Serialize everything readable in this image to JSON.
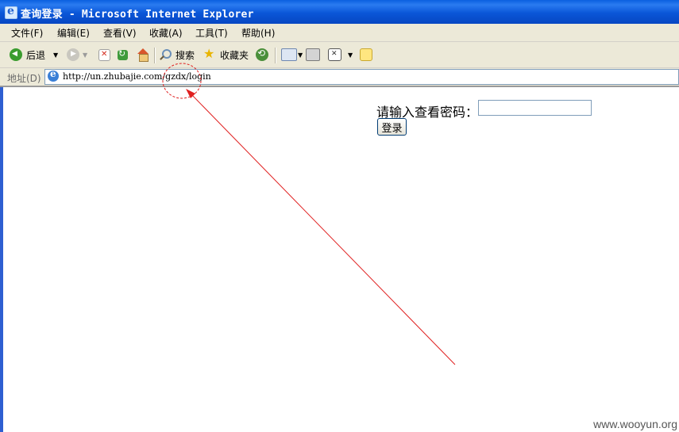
{
  "window": {
    "title": "查询登录 - Microsoft Internet Explorer"
  },
  "menu": {
    "items": [
      {
        "label": "文件(F)"
      },
      {
        "label": "编辑(E)"
      },
      {
        "label": "查看(V)"
      },
      {
        "label": "收藏(A)"
      },
      {
        "label": "工具(T)"
      },
      {
        "label": "帮助(H)"
      }
    ]
  },
  "toolbar": {
    "back_label": "后退",
    "search_label": "搜索",
    "favorites_label": "收藏夹"
  },
  "address": {
    "label": "地址(D)",
    "url": "http://un.zhubajie.com/gzdx/login"
  },
  "page": {
    "password_label": "请输入查看密码：",
    "password_value": "",
    "login_button": "登录"
  },
  "annotation": {
    "color": "#e02020"
  },
  "watermark": "www.wooyun.org"
}
